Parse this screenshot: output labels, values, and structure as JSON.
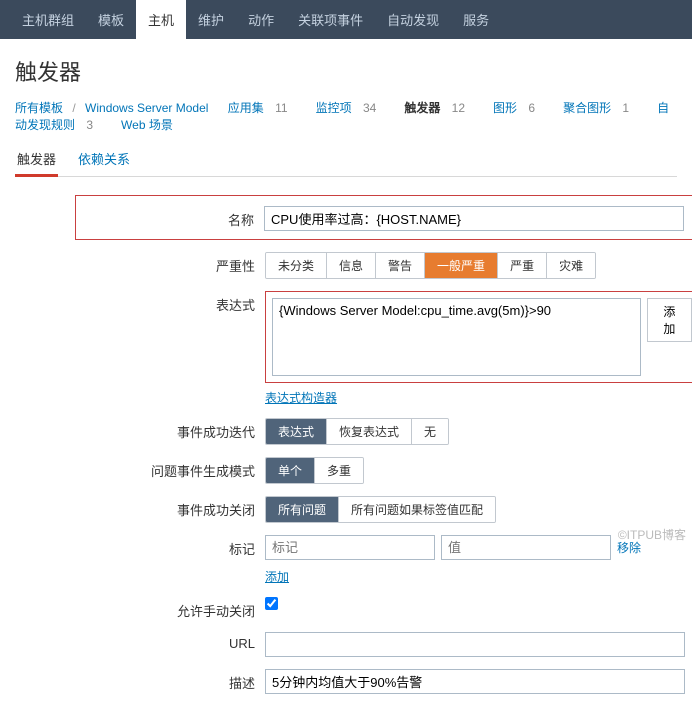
{
  "topnav": {
    "items": [
      "主机群组",
      "模板",
      "主机",
      "维护",
      "动作",
      "关联项事件",
      "自动发现",
      "服务"
    ],
    "activeIndex": 2
  },
  "page_title": "触发器",
  "breadcrumb": {
    "all_templates": "所有模板",
    "current": "Windows Server Model",
    "items": [
      {
        "label": "应用集",
        "count": "11"
      },
      {
        "label": "监控项",
        "count": "34"
      },
      {
        "label": "触发器",
        "count": "12",
        "active": true
      },
      {
        "label": "图形",
        "count": "6"
      },
      {
        "label": "聚合图形",
        "count": "1"
      },
      {
        "label": "自动发现规则",
        "count": "3"
      },
      {
        "label": "Web 场景",
        "count": ""
      }
    ]
  },
  "subtabs": {
    "items": [
      "触发器",
      "依赖关系"
    ],
    "activeIndex": 0
  },
  "labels": {
    "name": "名称",
    "severity": "严重性",
    "expression": "表达式",
    "add": "添加",
    "expr_builder": "表达式构造器",
    "recovery": "事件成功迭代",
    "problem_mode": "问题事件生成模式",
    "close_event": "事件成功关闭",
    "tags": "标记",
    "tag_placeholder": "标记",
    "value_placeholder": "值",
    "remove": "移除",
    "allow_manual": "允许手动关闭",
    "url": "URL",
    "description": "描述"
  },
  "fields": {
    "name": "CPU使用率过高：{HOST.NAME}",
    "expression": "{Windows Server Model:cpu_time.avg(5m)}>90",
    "url": "",
    "description": "5分钟内均值大于90%告警",
    "manual_close": true
  },
  "severity_options": [
    "未分类",
    "信息",
    "警告",
    "一般严重",
    "严重",
    "灾难"
  ],
  "severity_selected_index": 3,
  "recovery": {
    "options": [
      "表达式",
      "恢复表达式",
      "无"
    ],
    "sel": 0
  },
  "problem_mode": {
    "options": [
      "单个",
      "多重"
    ],
    "sel": 0
  },
  "close_event": {
    "options": [
      "所有问题",
      "所有问题如果标签值匹配"
    ],
    "sel": 0
  },
  "watermark": "©ITPUB博客"
}
